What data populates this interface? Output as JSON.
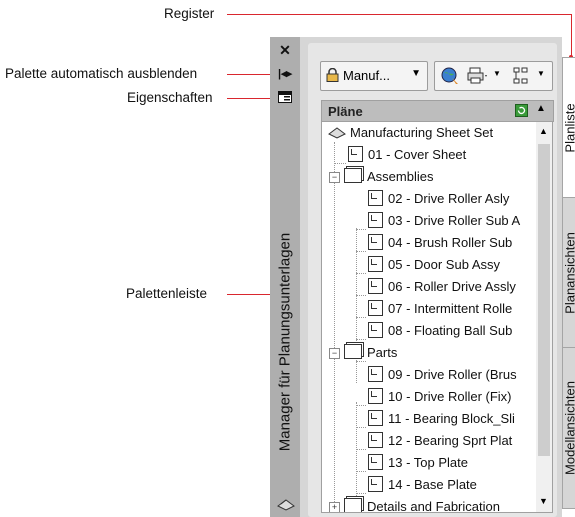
{
  "callouts": {
    "register": "Register",
    "autohide": "Palette automatisch ausblenden",
    "properties": "Eigenschaften",
    "palette_bar": "Palettenleiste"
  },
  "palette": {
    "title": "Manager für Planungsunterlagen",
    "sheetset_value": "Manuf...",
    "tree_header": "Pläne",
    "tree": {
      "root": "Manufacturing Sheet Set",
      "top_sheets": [
        "01 - Cover Sheet"
      ],
      "groups": [
        {
          "label": "Assemblies",
          "sheets": [
            "02 - Drive Roller Asly",
            "03 - Drive Roller Sub A",
            "04 - Brush Roller Sub",
            "05 - Door Sub Assy",
            "06 - Roller Drive Assly",
            "07 - Intermittent Rolle",
            "08 - Floating Ball Sub"
          ]
        },
        {
          "label": "Parts",
          "sheets": [
            "09 - Drive Roller (Brus",
            "10 - Drive Roller (Fix)",
            "11 - Bearing Block_Sli",
            "12 - Bearing Sprt Plat",
            "13 - Top Plate",
            "14 - Base Plate"
          ]
        },
        {
          "label": "Details and Fabrication",
          "sheets": []
        }
      ]
    },
    "tabs": [
      "Planliste",
      "Planansichten",
      "Modellansichten"
    ]
  },
  "icons": [
    "close-icon",
    "autohide-icon",
    "properties-icon",
    "lock-icon",
    "chevron-down-icon",
    "globe-icon",
    "publish-icon",
    "view-options-icon",
    "refresh-icon",
    "collapse-icon",
    "sheetset-icon",
    "sheet-icon",
    "folder-icon"
  ],
  "colors": {
    "callout_line": "#d9272e",
    "palette_bar": "#aeaeae",
    "panel_bg": "#d6d6d6",
    "refresh_green": "#3a9b3a"
  }
}
